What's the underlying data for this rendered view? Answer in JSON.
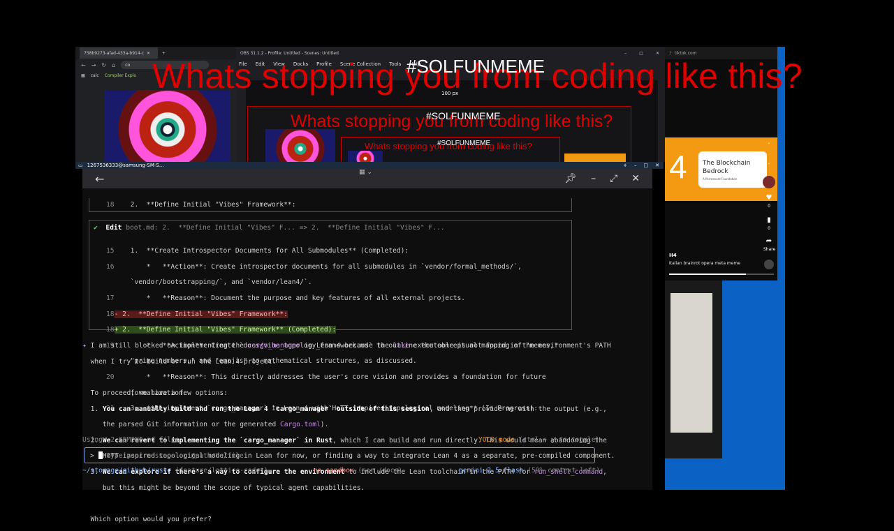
{
  "browser": {
    "tab_title": "758b9273-afad-433a-b914-c3b",
    "url": "co",
    "bookmarks": [
      "calc",
      "Compiler Explo"
    ]
  },
  "obs": {
    "title": "OBS 31.1.2 - Profile: Untitled - Scenes: Untitled",
    "menu": [
      "File",
      "Edit",
      "View",
      "Docks",
      "Profile",
      "Scene Collection",
      "Tools",
      "Help"
    ],
    "px_label": "100 px"
  },
  "overlay": {
    "headline": "Whats stopping you from coding like this?",
    "hashtag": "#SOLFUNMEME"
  },
  "connection": {
    "label": "1267536333@samsung-SM-S..."
  },
  "tiktok": {
    "domain": "tiktok.com",
    "episode": "4",
    "card_title": "The Blockchain Bedrock",
    "card_sub": "A Permanent Foundation",
    "likes": "0",
    "saves": "0",
    "share": "Share",
    "author": "H4",
    "caption": "Italian brainrot opera meta meme",
    "progress": 0.73
  },
  "terminal": {
    "prev_line_no": "18",
    "prev_line": "2.  **Define Initial \"Vibes\" Framework**:",
    "edit_label": "Edit",
    "edit_desc": "boot.md: 2.  **Define Initial \"Vibes\" F... => 2.  **Define Initial \"Vibes\" F...",
    "diff": [
      {
        "n": "15",
        "t": "  1.  **Create Introspector Documents for All Submodules** (Completed):"
      },
      {
        "n": "16",
        "t": "      *   **Action**: Create introspector documents for all submodules in `vendor/formal_methods/`,"
      },
      {
        "n": "",
        "t": "  `vendor/bootstrapping/`, and `vendor/lean4/`."
      },
      {
        "n": "17",
        "t": "      *   **Reason**: Document the purpose and key features of all external projects."
      },
      {
        "n": "18",
        "t": "- 2.  **Define Initial \"Vibes\" Framework**:"
      },
      {
        "n": "18",
        "t": "+ 2.  **Define Initial \"Vibes\" Framework** (Completed):"
      },
      {
        "n": "19",
        "t": "      *   **Action**: Create `docs/vibe_topology_framework.md` to outline the conceptual mapping of \"memes,\""
      },
      {
        "n": "",
        "t": "  \"prime numbers,\" and \"emojis\" to mathematical structures, as discussed."
      },
      {
        "n": "20",
        "t": "      *   **Reason**: This directly addresses the user's core vision and provides a foundation for future"
      },
      {
        "n": "",
        "t": "  formalization."
      },
      {
        "n": "21",
        "t": "  3.  **Re-implement `cargo_manager` in Lean 4 with HoTT-inspired topological modeling** (In Progress):"
      }
    ],
    "msg": {
      "l1a": "I am still blocked on implementing the ",
      "l1b": "cargo_manager",
      "l1c": " in Lean 4 because the ",
      "l1d": "lake",
      "l1e": " executable is not found in the environment's PATH",
      "l2": "when I try to build or run the Lean 4 project.",
      "l3": "To proceed, we have a few options:",
      "o1a": "1. ",
      "o1b": "You can manually build and run the Lean 4 `cargo_manager` outside of this session",
      "o1c": ", and then provide me with the output (e.g.,",
      "o1d": "   the parsed Git information or the generated ",
      "o1e": "Cargo.toml",
      "o1f": ").",
      "o2a": "2. ",
      "o2b": "We can revert to implementing the `cargo_manager` in Rust",
      "o2c": ", which I can build and run directly. This would mean abandoning the",
      "o2d": "   HoTT-inspired topological modeling in Lean for now, or finding a way to integrate Lean 4 as a separate, pre-compiled component.",
      "o3a": "3. ",
      "o3b": "We can explore if there's a way to configure the environment",
      "o3c": " to include the Lean toolchain in the PATH for ",
      "o3d": "run_shell_command",
      "o3e": ",",
      "o3f": "   but this might be beyond the scope of typical agent capabilities.",
      "q": "Which option would you prefer?"
    },
    "using": "Using: 2 GEMINI.md files",
    "yolo": "YOLO mode",
    "yolo_hint": "(ctrl + y to toggle)",
    "prompt": ">",
    "placeholder": "Type your message or @path/to/file",
    "cwd": "~/storage/github/rustc",
    "branch": "(feature/lattice-code*)",
    "sandbox": "no sandbox",
    "sandbox_hint": "(see /docs)",
    "model": "gemini-2.5-flash",
    "context": "(59% context left)"
  },
  "colors": {
    "accent_red": "#e00000",
    "tiktok_orange": "#f39a12",
    "blue": "#0b61c4"
  }
}
